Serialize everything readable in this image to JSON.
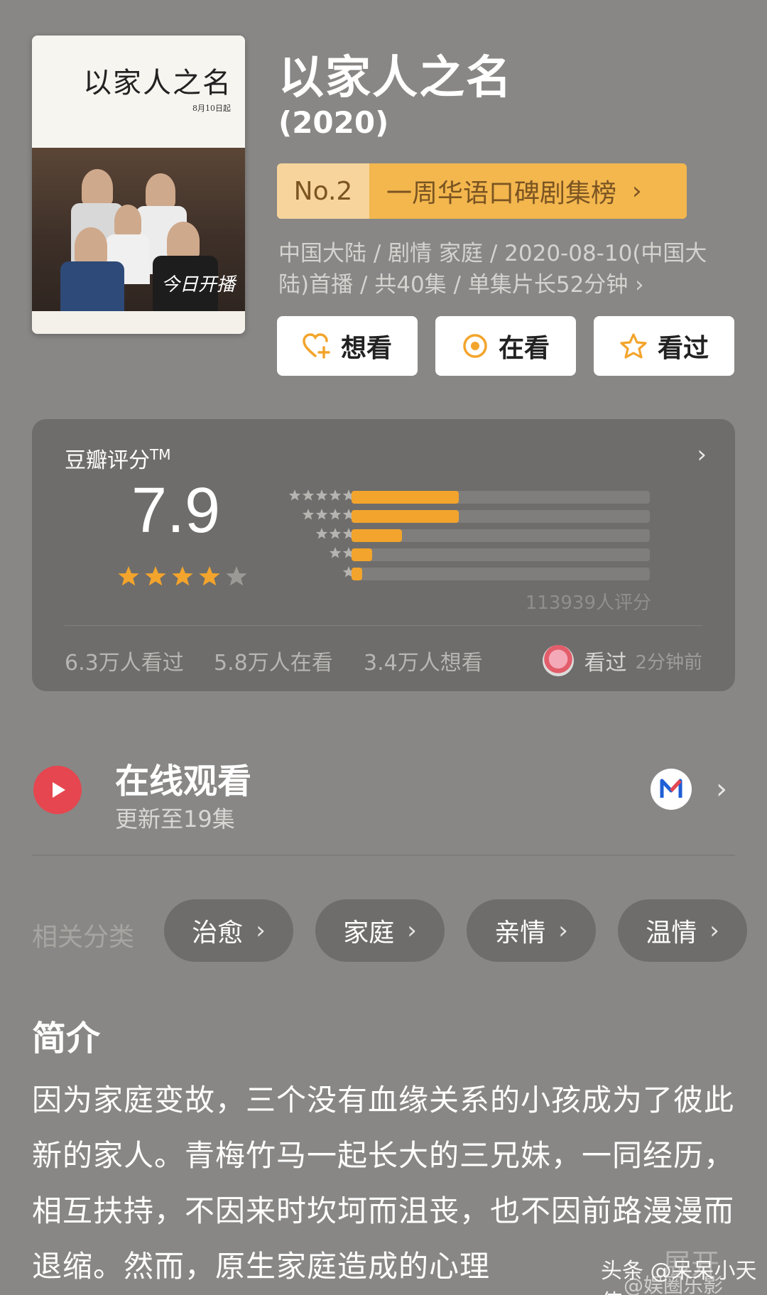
{
  "header": {
    "title": "以家人之名",
    "year": "(2020)",
    "poster": {
      "title_text": "以家人之名",
      "date_text": "8月10日起",
      "caption_text": "今日开播"
    }
  },
  "rank": {
    "number": "No.2",
    "name": "一周华语口碑剧集榜"
  },
  "meta": {
    "text": "中国大陆 / 剧情 家庭 / 2020-08-10(中国大陆)首播 / 共40集 / 单集片长52分钟 ›"
  },
  "actions": [
    {
      "label": "想看",
      "icon": "heart-plus-icon"
    },
    {
      "label": "在看",
      "icon": "target-circle-icon"
    },
    {
      "label": "看过",
      "icon": "star-outline-icon"
    }
  ],
  "rating": {
    "label": "豆瓣评分",
    "trademark": "TM",
    "score": "7.9",
    "stars": 4,
    "max_stars": 5,
    "count_text": "113939人评分",
    "distribution": [
      {
        "stars": 5,
        "fraction": 0.36
      },
      {
        "stars": 4,
        "fraction": 0.36
      },
      {
        "stars": 3,
        "fraction": 0.17
      },
      {
        "stars": 2,
        "fraction": 0.07
      },
      {
        "stars": 1,
        "fraction": 0.035
      }
    ],
    "stats": [
      "6.3万人看过",
      "5.8万人在看",
      "3.4万人想看"
    ],
    "friend": {
      "status": "看过",
      "time": "2分钟前"
    }
  },
  "online": {
    "title": "在线观看",
    "subtitle": "更新至19集"
  },
  "tags": {
    "label": "相关分类",
    "items": [
      "治愈",
      "家庭",
      "亲情",
      "温情"
    ]
  },
  "intro": {
    "heading": "简介",
    "text": "因为家庭变故，三个没有血缘关系的小孩成为了彼此新的家人。青梅竹马一起长大的三兄妹，一同经历，相互扶持，不因来时坎坷而沮丧，也不因前路漫漫而退缩。然而，原生家庭造成的心理",
    "expand": "展开"
  },
  "watermark": {
    "line1": "头条 @呆呆小天使",
    "line2": "@娱圈乐影"
  },
  "colors": {
    "background": "#888785",
    "card": "#6e6d6b",
    "accent_orange": "#f3a42c",
    "rank_light": "#f6d49b",
    "rank_dark": "#f3b74e",
    "play_red": "#e6464f"
  }
}
